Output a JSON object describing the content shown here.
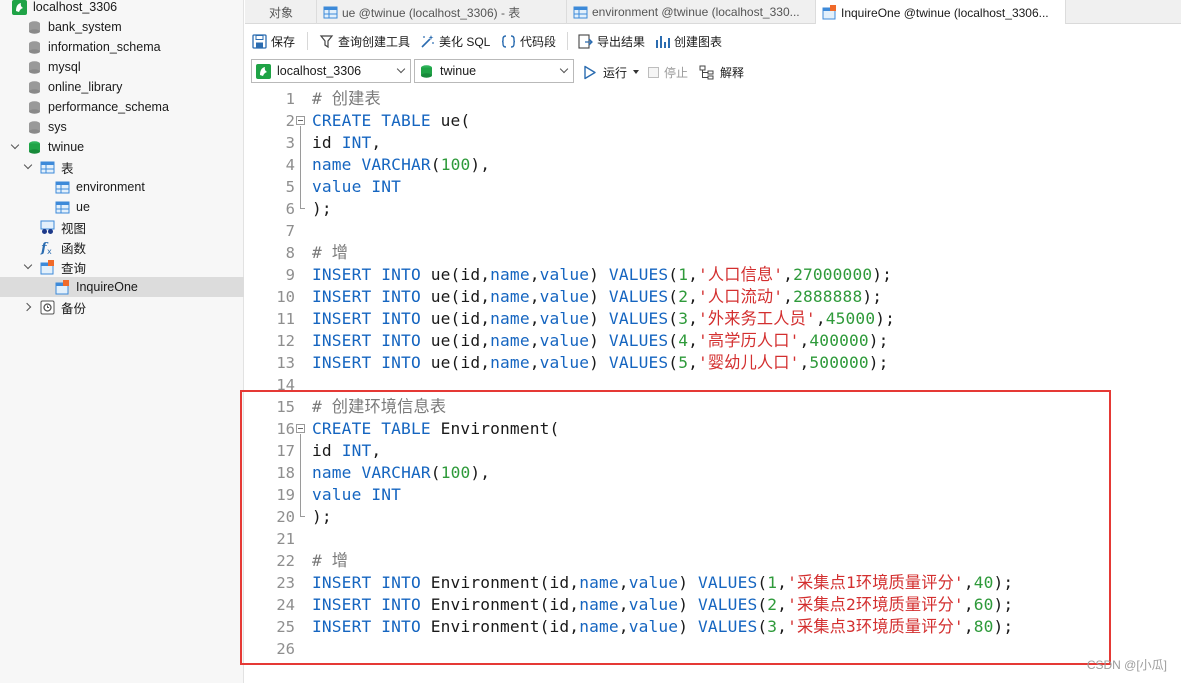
{
  "sidebar": {
    "connection": "localhost_3306",
    "databases": [
      "bank_system",
      "information_schema",
      "mysql",
      "online_library",
      "performance_schema",
      "sys"
    ],
    "open_db": "twinue",
    "tables_label": "表",
    "tables": [
      "environment",
      "ue"
    ],
    "views_label": "视图",
    "functions_label": "函数",
    "queries_label": "查询",
    "query_item": "InquireOne",
    "backup_label": "备份"
  },
  "tabs": {
    "objects": "对象",
    "items": [
      {
        "label": "ue @twinue (localhost_3306) - 表"
      },
      {
        "label": "environment @twinue (localhost_330..."
      },
      {
        "label": "InquireOne @twinue (localhost_3306..."
      }
    ]
  },
  "toolbar": {
    "save": "保存",
    "query_builder": "查询创建工具",
    "beautify": "美化 SQL",
    "snippet": "代码段",
    "export": "导出结果",
    "create_chart": "创建图表"
  },
  "connbar": {
    "connection": "localhost_3306",
    "database": "twinue",
    "run": "运行",
    "stop": "停止",
    "explain": "解释"
  },
  "colors": {
    "keyword": "#1565c0",
    "number": "#2e9a3a",
    "string": "#d32f2f",
    "comment": "#7a7a7a",
    "highlight_border": "#e53935"
  },
  "code": [
    [
      {
        "t": "# 创建表",
        "c": "cm"
      }
    ],
    [
      {
        "t": "CREATE TABLE",
        "c": "kw"
      },
      {
        "t": " ue("
      }
    ],
    [
      {
        "t": "id "
      },
      {
        "t": "INT",
        "c": "kw"
      },
      {
        "t": ","
      }
    ],
    [
      {
        "t": "name",
        "c": "kw"
      },
      {
        "t": " "
      },
      {
        "t": "VARCHAR",
        "c": "kw"
      },
      {
        "t": "("
      },
      {
        "t": "100",
        "c": "num"
      },
      {
        "t": "),"
      }
    ],
    [
      {
        "t": "value",
        "c": "kw"
      },
      {
        "t": " "
      },
      {
        "t": "INT",
        "c": "kw"
      }
    ],
    [
      {
        "t": ");"
      }
    ],
    [],
    [
      {
        "t": "# 增",
        "c": "cm"
      }
    ],
    [
      {
        "t": "INSERT INTO",
        "c": "kw"
      },
      {
        "t": " ue(id,"
      },
      {
        "t": "name",
        "c": "kw"
      },
      {
        "t": ","
      },
      {
        "t": "value",
        "c": "kw"
      },
      {
        "t": ") "
      },
      {
        "t": "VALUES",
        "c": "kw"
      },
      {
        "t": "("
      },
      {
        "t": "1",
        "c": "num"
      },
      {
        "t": ","
      },
      {
        "t": "'人口信息'",
        "c": "str"
      },
      {
        "t": ","
      },
      {
        "t": "27000000",
        "c": "num"
      },
      {
        "t": ");"
      }
    ],
    [
      {
        "t": "INSERT INTO",
        "c": "kw"
      },
      {
        "t": " ue(id,"
      },
      {
        "t": "name",
        "c": "kw"
      },
      {
        "t": ","
      },
      {
        "t": "value",
        "c": "kw"
      },
      {
        "t": ") "
      },
      {
        "t": "VALUES",
        "c": "kw"
      },
      {
        "t": "("
      },
      {
        "t": "2",
        "c": "num"
      },
      {
        "t": ","
      },
      {
        "t": "'人口流动'",
        "c": "str"
      },
      {
        "t": ","
      },
      {
        "t": "2888888",
        "c": "num"
      },
      {
        "t": ");"
      }
    ],
    [
      {
        "t": "INSERT INTO",
        "c": "kw"
      },
      {
        "t": " ue(id,"
      },
      {
        "t": "name",
        "c": "kw"
      },
      {
        "t": ","
      },
      {
        "t": "value",
        "c": "kw"
      },
      {
        "t": ") "
      },
      {
        "t": "VALUES",
        "c": "kw"
      },
      {
        "t": "("
      },
      {
        "t": "3",
        "c": "num"
      },
      {
        "t": ","
      },
      {
        "t": "'外来务工人员'",
        "c": "str"
      },
      {
        "t": ","
      },
      {
        "t": "45000",
        "c": "num"
      },
      {
        "t": ");"
      }
    ],
    [
      {
        "t": "INSERT INTO",
        "c": "kw"
      },
      {
        "t": " ue(id,"
      },
      {
        "t": "name",
        "c": "kw"
      },
      {
        "t": ","
      },
      {
        "t": "value",
        "c": "kw"
      },
      {
        "t": ") "
      },
      {
        "t": "VALUES",
        "c": "kw"
      },
      {
        "t": "("
      },
      {
        "t": "4",
        "c": "num"
      },
      {
        "t": ","
      },
      {
        "t": "'高学历人口'",
        "c": "str"
      },
      {
        "t": ","
      },
      {
        "t": "400000",
        "c": "num"
      },
      {
        "t": ");"
      }
    ],
    [
      {
        "t": "INSERT INTO",
        "c": "kw"
      },
      {
        "t": " ue(id,"
      },
      {
        "t": "name",
        "c": "kw"
      },
      {
        "t": ","
      },
      {
        "t": "value",
        "c": "kw"
      },
      {
        "t": ") "
      },
      {
        "t": "VALUES",
        "c": "kw"
      },
      {
        "t": "("
      },
      {
        "t": "5",
        "c": "num"
      },
      {
        "t": ","
      },
      {
        "t": "'婴幼儿人口'",
        "c": "str"
      },
      {
        "t": ","
      },
      {
        "t": "500000",
        "c": "num"
      },
      {
        "t": ");"
      }
    ],
    [],
    [
      {
        "t": "# 创建环境信息表",
        "c": "cm"
      }
    ],
    [
      {
        "t": "CREATE TABLE",
        "c": "kw"
      },
      {
        "t": " Environment("
      }
    ],
    [
      {
        "t": "id "
      },
      {
        "t": "INT",
        "c": "kw"
      },
      {
        "t": ","
      }
    ],
    [
      {
        "t": "name",
        "c": "kw"
      },
      {
        "t": " "
      },
      {
        "t": "VARCHAR",
        "c": "kw"
      },
      {
        "t": "("
      },
      {
        "t": "100",
        "c": "num"
      },
      {
        "t": "),"
      }
    ],
    [
      {
        "t": "value",
        "c": "kw"
      },
      {
        "t": " "
      },
      {
        "t": "INT",
        "c": "kw"
      }
    ],
    [
      {
        "t": ");"
      }
    ],
    [],
    [
      {
        "t": "# 增",
        "c": "cm"
      }
    ],
    [
      {
        "t": "INSERT INTO",
        "c": "kw"
      },
      {
        "t": " Environment(id,"
      },
      {
        "t": "name",
        "c": "kw"
      },
      {
        "t": ","
      },
      {
        "t": "value",
        "c": "kw"
      },
      {
        "t": ") "
      },
      {
        "t": "VALUES",
        "c": "kw"
      },
      {
        "t": "("
      },
      {
        "t": "1",
        "c": "num"
      },
      {
        "t": ","
      },
      {
        "t": "'采集点1环境质量评分'",
        "c": "str"
      },
      {
        "t": ","
      },
      {
        "t": "40",
        "c": "num"
      },
      {
        "t": ");"
      }
    ],
    [
      {
        "t": "INSERT INTO",
        "c": "kw"
      },
      {
        "t": " Environment(id,"
      },
      {
        "t": "name",
        "c": "kw"
      },
      {
        "t": ","
      },
      {
        "t": "value",
        "c": "kw"
      },
      {
        "t": ") "
      },
      {
        "t": "VALUES",
        "c": "kw"
      },
      {
        "t": "("
      },
      {
        "t": "2",
        "c": "num"
      },
      {
        "t": ","
      },
      {
        "t": "'采集点2环境质量评分'",
        "c": "str"
      },
      {
        "t": ","
      },
      {
        "t": "60",
        "c": "num"
      },
      {
        "t": ");"
      }
    ],
    [
      {
        "t": "INSERT INTO",
        "c": "kw"
      },
      {
        "t": " Environment(id,"
      },
      {
        "t": "name",
        "c": "kw"
      },
      {
        "t": ","
      },
      {
        "t": "value",
        "c": "kw"
      },
      {
        "t": ") "
      },
      {
        "t": "VALUES",
        "c": "kw"
      },
      {
        "t": "("
      },
      {
        "t": "3",
        "c": "num"
      },
      {
        "t": ","
      },
      {
        "t": "'采集点3环境质量评分'",
        "c": "str"
      },
      {
        "t": ","
      },
      {
        "t": "80",
        "c": "num"
      },
      {
        "t": ");"
      }
    ],
    []
  ],
  "watermark": "CSDN @[小瓜]"
}
